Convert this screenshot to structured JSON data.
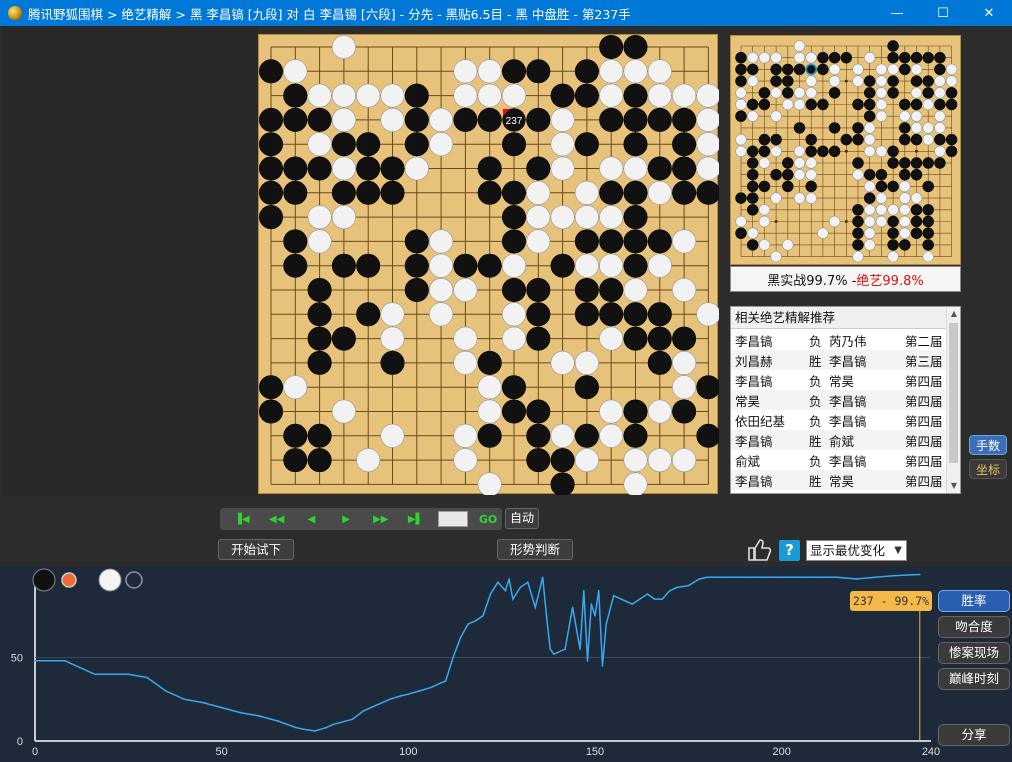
{
  "window": {
    "app_name": "腾讯野狐围棋",
    "title": "腾讯野狐围棋 > 绝艺精解 > 黑 李昌镐 [九段] 对 白 李昌锡 [六段] - 分先 - 黑贴6.5目 - 黑 中盘胜 - 第237手",
    "minimize": "—",
    "maximize": "☐",
    "close": "✕"
  },
  "board": {
    "size": 19,
    "last_move_label": "237",
    "stones": [
      "...W..........BB...",
      "BW......WWBB.BWWW..",
      ".BWWWWB.WWW.BBWBWWW",
      "BBBW.WBWBB.BW.BBBBW",
      "B.WBB.BW..B.WB.B.BW",
      "BBBWBBW..B.BW.WWBBW",
      "BB.BBB...BBW.WBBWBB",
      "B.WW......BWWWWB...",
      ".BW...BW..BW.BBBBW.",
      ".B.BB.BWBBW.BWWBW..",
      "..B...BWW.BB.BBW.W.",
      "..B.BW.W..WB.BBBB.W",
      "..BB.W..W.WB..WBBB.",
      "..B..B..WB..WW..BW.",
      "BW.......WB..B...WB",
      "B..W.....WBB..WBWB.",
      ".BB..W..WB.BWBWB..B",
      ".BB.W...W..BBW.WWW.",
      ".........W..B..W..."
    ]
  },
  "miniboard": {
    "caption_prefix": "黑实战99.7% - ",
    "caption_ai": "绝艺99.8%",
    "stones": [
      ".....W.......B.....",
      "BWWW.WWBBB.W.BBBBB.",
      "BB.BBBBBW.W.WWBW.BW",
      "BW.BB.W.W.WBWB.BBWW",
      "W.BWBWW.B..BWB.WBWB",
      "WBB.WWBB..BBW.BBWBB",
      "BW.W.......BW.WW.W.",
      ".....B..B.BW..BWWW.",
      "W.BB..B..BBW..BBWBB",
      "WBBW.WBBB..WWB...WB",
      ".BW.BWW...B..BBBBB.",
      ".B.BBWW...WBB.BB...",
      ".BB.B.B....WBBW.B..",
      "BB.W.WW....BW.WW...",
      ".BW.......BWWWWBB..",
      "W.W.....W.BWWBWBB..",
      "BW.....W..BW.BWBB..",
      ".BW.W.....BW.BB.B..",
      "...W......W..W..W.."
    ]
  },
  "recommend": {
    "header": "相关绝艺精解推荐",
    "rows": [
      {
        "black": "李昌镐",
        "result": "负",
        "white": "芮乃伟",
        "event": "第二届"
      },
      {
        "black": "刘昌赫",
        "result": "胜",
        "white": "李昌镐",
        "event": "第三届"
      },
      {
        "black": "李昌镐",
        "result": "负",
        "white": "常昊",
        "event": "第四届"
      },
      {
        "black": "常昊",
        "result": "负",
        "white": "李昌镐",
        "event": "第四届"
      },
      {
        "black": "依田纪基",
        "result": "负",
        "white": "李昌镐",
        "event": "第四届"
      },
      {
        "black": "李昌镐",
        "result": "胜",
        "white": "俞斌",
        "event": "第四届"
      },
      {
        "black": "俞斌",
        "result": "负",
        "white": "李昌镐",
        "event": "第四届"
      },
      {
        "black": "李昌镐",
        "result": "胜",
        "white": "常昊",
        "event": "第四届"
      }
    ]
  },
  "side_tabs": {
    "moves": "手数",
    "coords": "坐标"
  },
  "controls": {
    "go": "GO",
    "auto": "自动",
    "try": "开始试下",
    "judge": "形势判断",
    "select": "显示最优变化"
  },
  "chart_tabs": {
    "winrate": "胜率",
    "match": "吻合度",
    "tragedy": "惨案现场",
    "peak": "巅峰时刻",
    "share": "分享"
  },
  "chart_tag": "237 - 99.7%",
  "colors": {
    "accent": "#3a6fb8",
    "line": "#3aa8ee",
    "tag": "#f5b84a",
    "ai_red": "#e01010"
  },
  "chart_data": {
    "type": "line",
    "xlabel": "",
    "ylabel": "",
    "xlim": [
      0,
      240
    ],
    "ylim": [
      0,
      100
    ],
    "x_ticks": [
      "0",
      "50",
      "100",
      "150",
      "200",
      "240"
    ],
    "y_ticks": [
      "0",
      "50"
    ],
    "marker_x": 237,
    "series": [
      {
        "x": [
          0,
          8,
          12,
          16,
          20,
          25,
          30,
          35,
          40,
          45,
          50,
          55,
          60,
          65,
          70,
          72,
          75,
          78,
          80,
          85,
          88,
          90,
          92,
          95,
          98,
          100,
          103,
          106,
          108,
          110,
          112,
          114,
          116,
          117,
          118,
          120,
          122,
          124,
          126,
          127,
          128,
          130,
          132,
          134,
          136,
          137,
          138,
          139,
          140,
          142,
          144,
          146,
          147,
          148,
          149,
          150,
          151,
          152,
          153,
          155,
          157,
          160,
          162,
          164,
          166,
          168,
          170,
          172,
          175,
          178,
          180,
          185,
          190,
          195,
          200,
          205,
          210,
          215,
          220,
          225,
          230,
          235,
          237
        ],
        "y": [
          48,
          48,
          44,
          40,
          40,
          40,
          38,
          30,
          25,
          23,
          20,
          17,
          15,
          12,
          8,
          7,
          6,
          8,
          10,
          13,
          18,
          20,
          22,
          25,
          27,
          28,
          30,
          32,
          34,
          36,
          50,
          62,
          70,
          71,
          72,
          75,
          88,
          95,
          90,
          97,
          85,
          92,
          95,
          80,
          98,
          75,
          55,
          52,
          53,
          55,
          80,
          55,
          90,
          48,
          82,
          75,
          90,
          45,
          70,
          87,
          85,
          82,
          85,
          88,
          85,
          85,
          90,
          92,
          93,
          97,
          98,
          98,
          98,
          98,
          98,
          98,
          98,
          98,
          97,
          98,
          99,
          99.5,
          99.7
        ]
      }
    ]
  }
}
